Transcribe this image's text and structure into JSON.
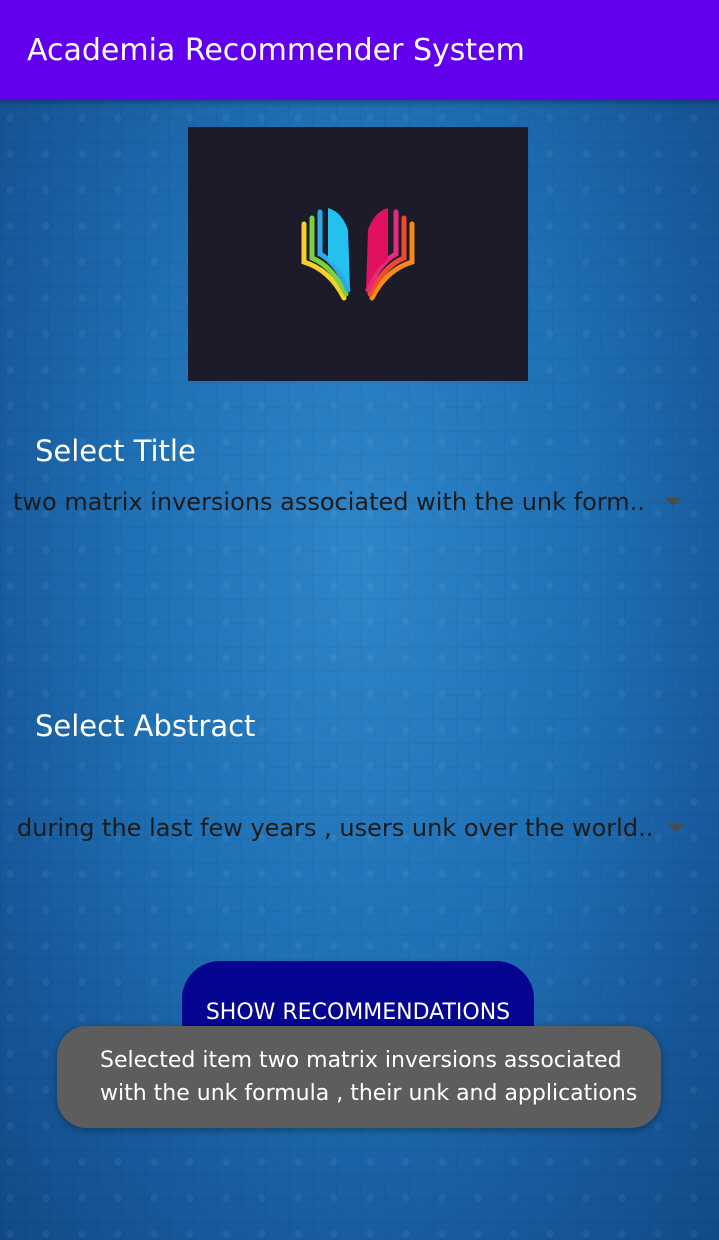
{
  "appbar": {
    "title": "Academia Recommender System",
    "color": "#6200ee"
  },
  "logo": {
    "icon": "open-book-logo-icon"
  },
  "title_select": {
    "label": "Select Title",
    "selected": "two matrix inversions associated with the unk form.."
  },
  "abstract_select": {
    "label": "Select Abstract",
    "selected": "during the last few years , users unk over the world.."
  },
  "recommend_button": {
    "label": "SHOW RECOMMENDATIONS",
    "color": "#060591"
  },
  "toast": {
    "message": "Selected item two matrix inversions associated with the unk formula , their unk and applications"
  }
}
